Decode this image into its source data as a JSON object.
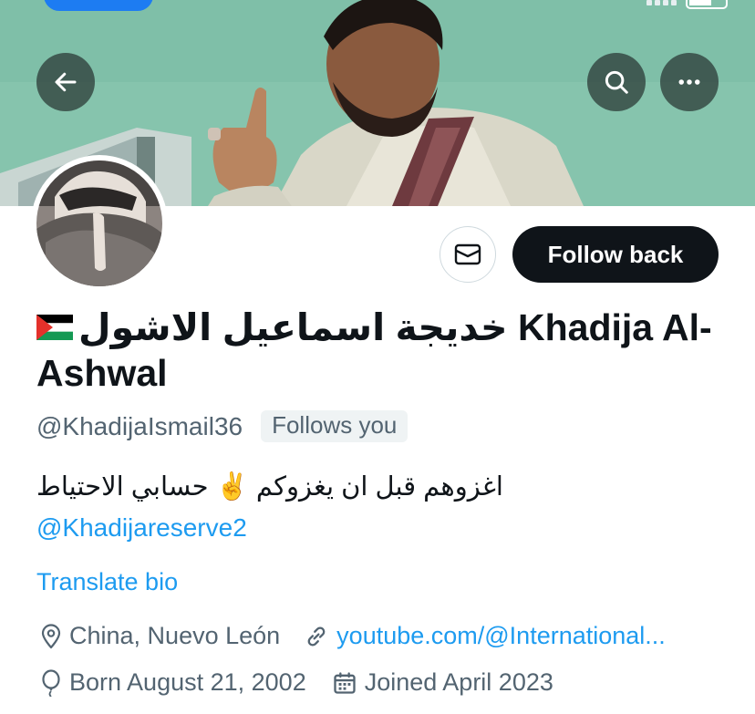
{
  "header": {
    "back_icon": "arrow-left-icon",
    "search_icon": "search-icon",
    "more_icon": "more-horizontal-icon"
  },
  "actions": {
    "message_icon": "envelope-icon",
    "follow_label": "Follow back"
  },
  "profile": {
    "flag_icon": "palestine-flag-icon",
    "name": "خديجة اسماعيل الاشول Khadija Al-Ashwal",
    "handle": "@KhadijaIsmail36",
    "follows_you": "Follows you",
    "bio_text": "اغزوهم قبل ان يغزوكم ✌️ حسابي الاحتياط",
    "bio_link": "@Khadijareserve2",
    "translate": "Translate bio"
  },
  "meta": {
    "location": "China, Nuevo León",
    "website": "youtube.com/@International...",
    "birthday": "Born August 21, 2002",
    "joined": "Joined April 2023"
  },
  "colors": {
    "accent": "#1d9bf0",
    "text_primary": "#0f1419",
    "text_secondary": "#536471",
    "follow_button_bg": "#0f1419",
    "badge_bg": "#eff3f4"
  }
}
